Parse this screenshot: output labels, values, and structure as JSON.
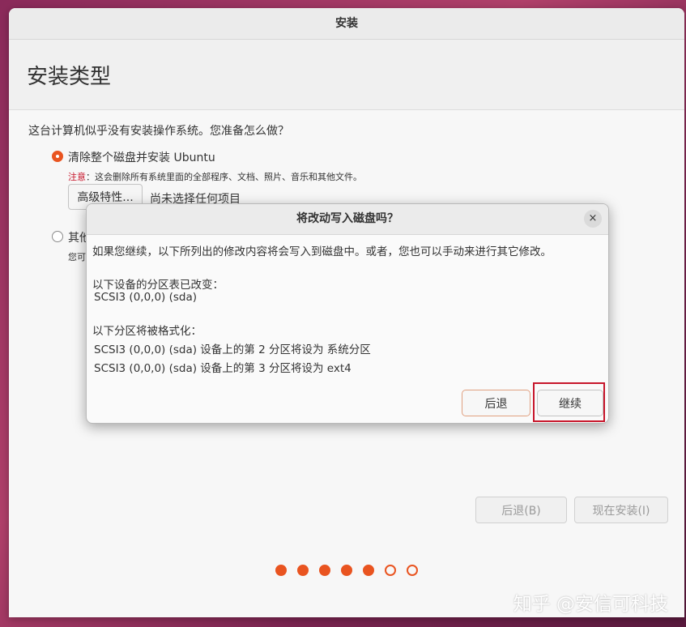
{
  "window": {
    "title": "安装"
  },
  "page": {
    "title": "安装类型",
    "question": "这台计算机似乎没有安装操作系统。您准备怎么做？"
  },
  "options": [
    {
      "label": "清除整个磁盘并安装 Ubuntu",
      "selected": true,
      "note_warning": "注意",
      "note_text": "：这会删除所有系统里面的全部程序、文档、照片、音乐和其他文件。",
      "advanced_button": "高级特性...",
      "advanced_status": "尚未选择任何项目"
    },
    {
      "label": "其他",
      "selected": false,
      "note_text": "您可"
    }
  ],
  "nav": {
    "back": "后退(B)",
    "install_now": "现在安装(I)"
  },
  "progress": {
    "total": 7,
    "completed": 5
  },
  "dialog": {
    "title": "将改动写入磁盘吗？",
    "close_icon": "×",
    "intro": "如果您继续，以下所列出的修改内容将会写入到磁盘中。或者，您也可以手动来进行其它修改。",
    "partition_table_header": "以下设备的分区表已改变：",
    "partition_table_devices": [
      "SCSI3 (0,0,0) (sda)"
    ],
    "format_header": "以下分区将被格式化：",
    "format_items": [
      "SCSI3 (0,0,0) (sda) 设备上的第 2 分区将设为 系统分区",
      "SCSI3 (0,0,0) (sda) 设备上的第 3 分区将设为 ext4"
    ],
    "back_button": "后退",
    "continue_button": "继续"
  },
  "watermark": "知乎 @安信可科技",
  "colors": {
    "accent": "#e95420",
    "highlight": "#c7162b"
  }
}
